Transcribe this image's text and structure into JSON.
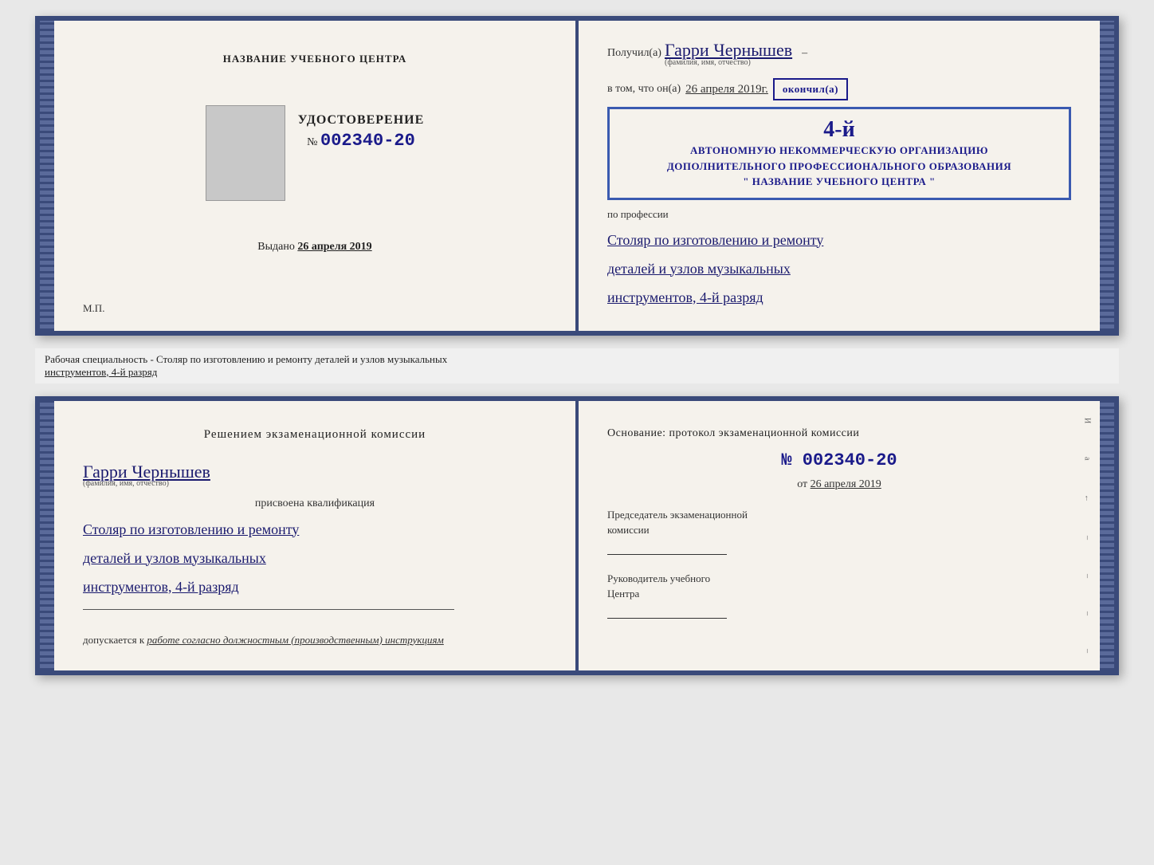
{
  "top_spread": {
    "left": {
      "center_title": "НАЗВАНИЕ УЧЕБНОГО ЦЕНТРА",
      "udostoverenie_title": "УДОСТОВЕРЕНИЕ",
      "number_prefix": "№",
      "number": "002340-20",
      "issued_label": "Выдано",
      "issued_date": "26 апреля 2019",
      "mp_label": "М.П."
    },
    "right": {
      "poluchil_prefix": "Получил(а)",
      "name_handwritten": "Гарри Чернышев",
      "fio_label": "(фамилия, имя, отчество)",
      "dash": "–",
      "vtom_prefix": "в том, что он(а)",
      "vtom_date": "26 апреля 2019г.",
      "okonchil": "окончил(а)",
      "stamp_grade": "4-й",
      "stamp_line2": "АВТОНОМНУЮ НЕКОММЕРЧЕСКУЮ ОРГАНИЗАЦИЮ",
      "stamp_line3": "ДОПОЛНИТЕЛЬНОГО ПРОФЕССИОНАЛЬНОГО ОБРАЗОВАНИЯ",
      "stamp_line4": "\" НАЗВАНИЕ УЧЕБНОГО ЦЕНТРА \"",
      "po_professii": "по профессии",
      "profession_line1": "Столяр по изготовлению и ремонту",
      "profession_line2": "деталей и узлов музыкальных",
      "profession_line3": "инструментов, 4-й разряд"
    }
  },
  "caption": {
    "text_start": "Рабочая специальность - Столяр по изготовлению и ремонту деталей и узлов музыкальных",
    "text_underline": "инструментов, 4-й разряд"
  },
  "bottom_spread": {
    "left": {
      "resheniem": "Решением  экзаменационной  комиссии",
      "name_handwritten": "Гарри Чернышев",
      "fio_label": "(фамилия, имя, отчество)",
      "prisvoena": "присвоена квалификация",
      "profession_line1": "Столяр по изготовлению и ремонту",
      "profession_line2": "деталей и узлов музыкальных",
      "profession_line3": "инструментов, 4-й разряд",
      "dopuskaetsya_prefix": "допускается к",
      "dopuskaetsya_italic": "работе согласно должностным (производственным) инструкциям"
    },
    "right": {
      "osnovanie": "Основание: протокол экзаменационной  комиссии",
      "number_prefix": "№",
      "number": "002340-20",
      "ot_prefix": "от",
      "ot_date": "26 апреля 2019",
      "predsedatel_line1": "Председатель экзаменационной",
      "predsedatel_line2": "комиссии",
      "rukovoditel_line1": "Руководитель учебного",
      "rukovoditel_line2": "Центра"
    },
    "right_margin_labels": [
      "И",
      "а",
      "←",
      "–",
      "–",
      "–",
      "–"
    ]
  }
}
